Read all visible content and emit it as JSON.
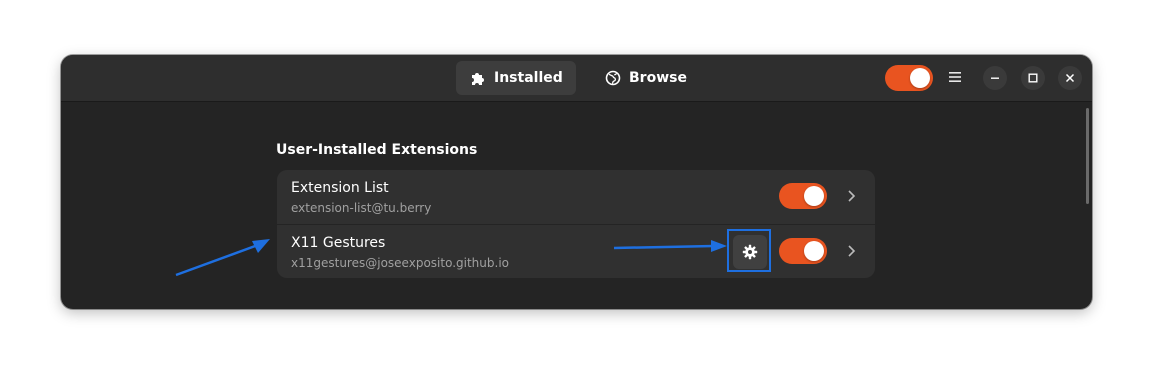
{
  "header": {
    "tabs": [
      {
        "label": "Installed",
        "icon": "puzzle-icon",
        "active": true
      },
      {
        "label": "Browse",
        "icon": "globe-icon",
        "active": false
      }
    ],
    "extensions_master_toggle": true,
    "menu_icon": "hamburger-icon",
    "window_buttons": [
      "minimize-icon",
      "maximize-icon",
      "close-icon"
    ]
  },
  "main": {
    "section_title": "User-Installed Extensions",
    "extensions": [
      {
        "name": "Extension List",
        "uuid": "extension-list@tu.berry",
        "enabled": true,
        "has_settings": false
      },
      {
        "name": "X11 Gestures",
        "uuid": "x11gestures@joseexposito.github.io",
        "enabled": true,
        "has_settings": true
      }
    ]
  },
  "annotations": {
    "arrow_color": "#1e6fe0",
    "highlight_color": "#1e6fe0"
  },
  "colors": {
    "accent": "#e95420",
    "window_bg": "#242424",
    "headerbar_bg": "#2e2e2e",
    "row_bg": "#303030"
  }
}
